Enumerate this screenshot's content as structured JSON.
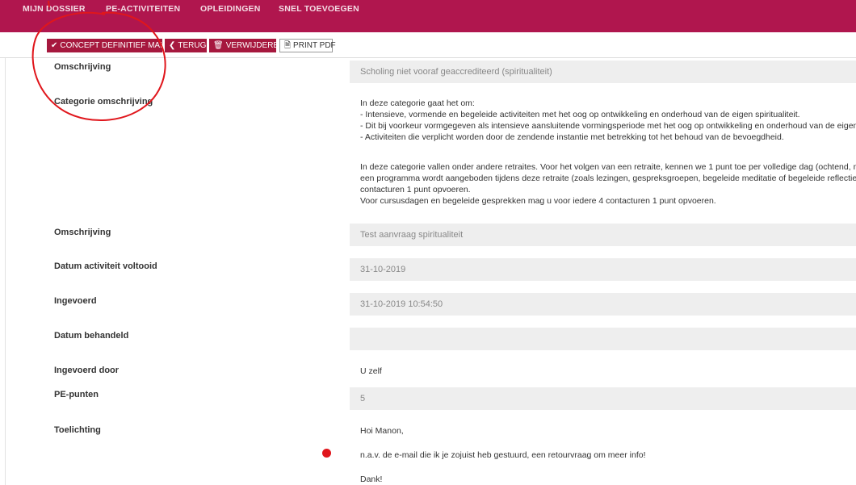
{
  "nav": {
    "items": [
      "Mijn dossier",
      "PE-activiteiten",
      "Opleidingen",
      "Snel toevoegen"
    ]
  },
  "toolbar": {
    "concept_label": "CONCEPT DEFINITIEF MAKEN",
    "terug_label": "TERUG",
    "verwijderen_label": "VERWIJDEREN",
    "print_label": "PRINT PDF"
  },
  "form": {
    "omschrijving_label": "Omschrijving",
    "omschrijving_value": "Scholing niet vooraf geaccrediteerd (spiritualiteit)",
    "categorie_label": "Categorie omschrijving",
    "categorie_lines": [
      "In deze categorie gaat het om:",
      "- Intensieve, vormende en begeleide activiteiten met het oog op ontwikkeling en onderhoud van de eigen spiritualiteit.",
      "- Dit bij voorkeur vormgegeven als intensieve aansluitende vormingsperiode met het oog op ontwikkeling en onderhoud van de eigen sp",
      "- Activiteiten die verplicht worden door de zendende instantie met betrekking tot het behoud van de bevoegdheid."
    ],
    "categorie_lines2": [
      "In deze categorie vallen onder andere retraites. Voor het volgen van een retraite, kennen we 1 punt toe per volledige dag (ochtend, midda",
      "een programma wordt aangeboden tijdens deze retraite (zoals lezingen, gespreksgroepen, begeleide meditatie of begeleide reflectie) u",
      "contacturen 1 punt opvoeren.",
      "Voor cursusdagen en begeleide gesprekken mag u voor iedere 4 contacturen 1 punt opvoeren."
    ],
    "omschrijving2_label": "Omschrijving",
    "omschrijving2_value": "Test aanvraag spiritualiteit",
    "datum_voltooid_label": "Datum activiteit voltooid",
    "datum_voltooid_value": "31-10-2019",
    "ingevoerd_label": "Ingevoerd",
    "ingevoerd_value": "31-10-2019 10:54:50",
    "datum_behandeld_label": "Datum behandeld",
    "datum_behandeld_value": "",
    "ingevoerd_door_label": "Ingevoerd door",
    "ingevoerd_door_value": "U zelf",
    "pe_punten_label": "PE-punten",
    "pe_punten_value": "5",
    "toelichting_label": "Toelichting",
    "toelichting_lines": [
      "Hoi Manon,",
      "n.a.v. de e-mail die ik je zojuist heb gestuurd, een retourvraag om meer info!",
      "Dank!"
    ]
  },
  "annotation_color": "#e0161c",
  "brand_color": "#b0164e"
}
